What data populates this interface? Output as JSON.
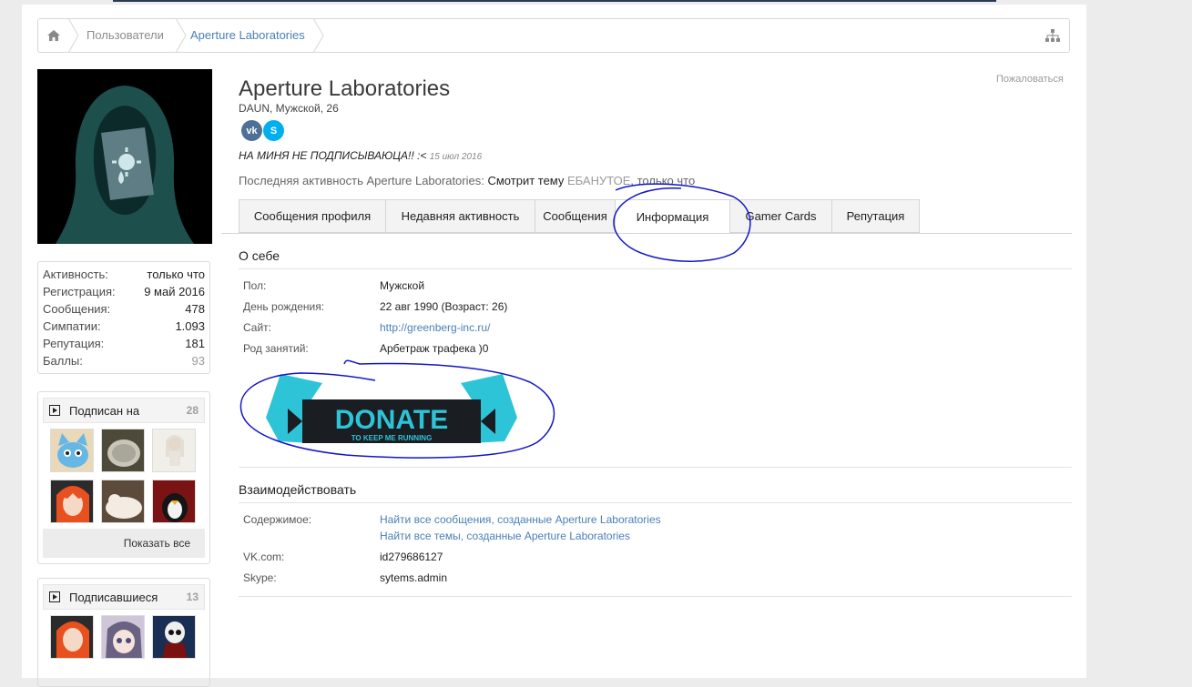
{
  "breadcrumb": {
    "home_icon": "home-icon",
    "items": [
      "Пользователи",
      "Aperture Laboratories"
    ],
    "sitemap_icon": "sitemap-icon"
  },
  "stats": [
    {
      "label": "Активность:",
      "value": "только что"
    },
    {
      "label": "Регистрация:",
      "value": "9 май 2016"
    },
    {
      "label": "Сообщения:",
      "value": "478"
    },
    {
      "label": "Симпатии:",
      "value": "1.093"
    },
    {
      "label": "Репутация:",
      "value": "181"
    },
    {
      "label": "Баллы:",
      "value": "93"
    }
  ],
  "following": {
    "title": "Подписан на",
    "count": "28",
    "show_all": "Показать все"
  },
  "followers": {
    "title": "Подписавшиеся",
    "count": "13"
  },
  "profile": {
    "report": "Пожаловаться",
    "name": "Aperture Laboratories",
    "subline": "DAUN, Мужской, 26",
    "social": [
      "vk-icon",
      "skype-icon"
    ],
    "status_text": "НА МИНЯ НЕ ПОДПИСЫВАЮЦА!! :<",
    "status_date": "15 июл 2016",
    "last_activity_prefix": "Последняя активность Aperture Laboratories:",
    "last_activity_action": "Смотрит тему",
    "last_activity_thread": "ЕБАНУТОЕ",
    "last_activity_time": ", только что"
  },
  "tabs": [
    "Сообщения профиля",
    "Недавняя активность",
    "Сообщения",
    "Информация",
    "Gamer Cards",
    "Репутация"
  ],
  "active_tab": "Информация",
  "about": {
    "title": "О себе",
    "rows": [
      {
        "label": "Пол:",
        "value": "Мужской"
      },
      {
        "label": "День рождения:",
        "value": "22 авг 1990 (Возраст: 26)"
      },
      {
        "label": "Сайт:",
        "value": "http://greenberg-inc.ru/"
      },
      {
        "label": "Род занятий:",
        "value": "Арбетраж трафека )0"
      }
    ],
    "donate_text": "DONATE",
    "donate_sub": "TO KEEP ME RUNNING"
  },
  "interact": {
    "title": "Взаимодействовать",
    "content_label": "Содержимое:",
    "content_links": [
      "Найти все сообщения, созданные Aperture Laboratories",
      "Найти все темы, созданные Aperture Laboratories"
    ],
    "vk_label": "VK.com:",
    "vk_value": "id279686127",
    "skype_label": "Skype:",
    "skype_value": "sytems.admin"
  },
  "colors": {
    "link": "#4a7fb5",
    "annotation": "#1414c8",
    "donate_accent": "#2ec4d8"
  }
}
